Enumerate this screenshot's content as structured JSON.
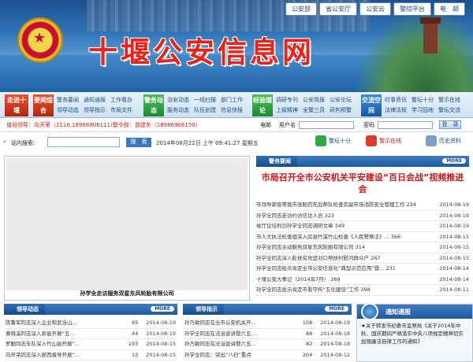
{
  "header": {
    "site_title": "十堰公安信息网",
    "top_links": [
      "公安部",
      "省公安厅",
      "公安云",
      "警综平台",
      "电　邮"
    ]
  },
  "nav": {
    "groups": [
      {
        "head": "走进十堰",
        "links": []
      },
      {
        "head": "要闻综合",
        "links": [
          "警务要闻",
          "通知通报",
          "工作看办",
          "领导动态",
          "领导指示",
          "市局文件"
        ]
      },
      {
        "head": "警务动态",
        "links": [
          "治安动态",
          "一线扫描",
          "部门工作",
          "服务动态",
          "队伍创建",
          "信息快报"
        ]
      },
      {
        "head": "经验理论",
        "links": [
          "调研专刊",
          "公安简报",
          "公安论坛",
          "上级精神",
          "全警三员",
          "研判预警"
        ]
      },
      {
        "head": "交流空间",
        "links": [
          "时事资讯",
          "警坛十分",
          "警示在线",
          "法律法规",
          "学习园地",
          "警坛交流"
        ]
      }
    ]
  },
  "infobar": {
    "duty": "值班领导：向开荣（2116,18986906111)警令部：曾建东（18986906150）",
    "account_label": "电邮",
    "username_label": "用户名",
    "password_label": "密码",
    "login_button": "登　录"
  },
  "search": {
    "label": "站内搜索:",
    "button": "搜　索",
    "datetime": "2014年08月22日 上午 09:41:27 星期五",
    "quick_links": [
      "警坛十分",
      "警示在线",
      "历史资料"
    ]
  },
  "video": {
    "caption": "孙学全走访服务双星东风轮胎有限公司"
  },
  "news": {
    "section": "警务要闻",
    "more": "MORE",
    "headline": "市局召开全市公安机关平安建设“百日会战”视频推进会",
    "items": [
      {
        "title": "市领导郭俊等我市张聪药先后帮队检查农副市场消防安全管理工作 224",
        "date": "2014-08-19"
      },
      {
        "title": "孙学全同志走访约访信访人员 323",
        "date": "2014-08-19"
      },
      {
        "title": "省厅论坛利剑孙学全同志调研文章 349",
        "date": "2014-08-19"
      },
      {
        "title": "市人大执法检查组深入房县竹溪竹山检查《人民警察法》... 366",
        "date": "2014-08-15"
      },
      {
        "title": "孙学全同志主动服务双星东风轮胎有限公司 314",
        "date": "2014-08-15"
      },
      {
        "title": "孙学全同志深入赴扶贫攻坚对口帮扶村慰问群众户 267",
        "date": "2014-08-15"
      },
      {
        "title": "孙学全同志批示肯定全市公安信息化“典型示范应用”暨... 231",
        "date": "2014-08-14"
      },
      {
        "title": "十堰公安大事记（2014年7月） 269",
        "date": "2014-08-14"
      },
      {
        "title": "孙学全同志批示肯定市看守所“五化建设”工作 398",
        "date": "2014-08-11"
      }
    ]
  },
  "leaders": {
    "section": "领导动态",
    "more": "MORE",
    "items": [
      {
        "title": "陈鲁军同志深入企业和武当山...",
        "count": "95",
        "date": "2014-08-19"
      },
      {
        "title": "黄晓溪同志深入郧县开展“五...",
        "count": "44",
        "date": "2014-08-19"
      },
      {
        "title": "罗勤同志车队深入竹山县开展“...",
        "count": "193",
        "date": "2014-08-15"
      },
      {
        "title": "向开荣同志深入郧西督导开展“...",
        "count": "13",
        "date": "2014-08-15"
      }
    ]
  },
  "instructions": {
    "section": "领导指示",
    "more": "MORE",
    "items": [
      {
        "title": "孙乃敏同志在全市公安机关开...",
        "count": "108",
        "date": "2014-08-19"
      },
      {
        "title": "孙学全同志在法治宣讲暨六五...",
        "count": "88",
        "date": "2014-08-18"
      },
      {
        "title": "孙乃敏同志在法治宣讲暨六五...",
        "count": "82",
        "date": "2014-08-18"
      },
      {
        "title": "孙学全同志：突出“八扫”重点",
        "count": "204",
        "date": "2014-08-12"
      }
    ]
  },
  "notice": {
    "section": "通知通报",
    "text": "★关于转发市纪委市监察局《关于2014年中秋、国庆期间严格落实中央八项规定精神切实加强廉洁自律工作的通知》"
  }
}
